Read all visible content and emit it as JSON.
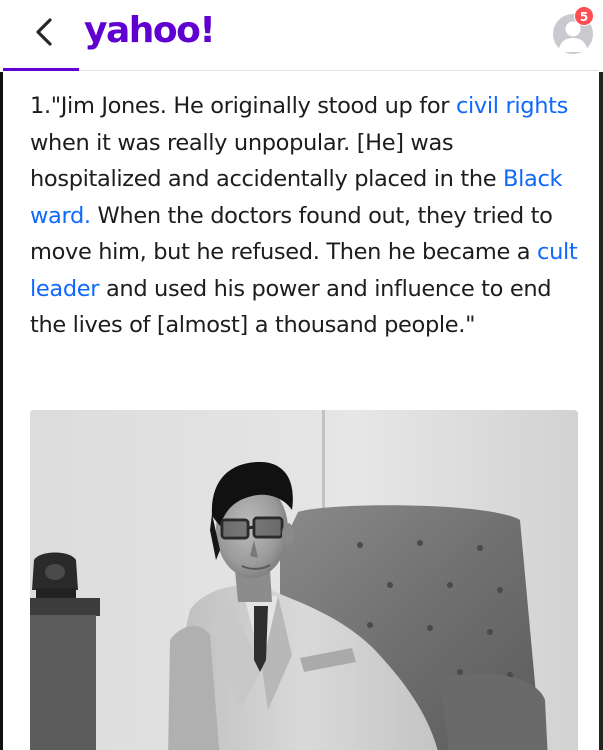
{
  "header": {
    "logo_text": "yahoo!",
    "notification_count": "5",
    "back_icon": "chevron-left-icon",
    "avatar_icon": "user-avatar-icon",
    "brand_color": "#6001d2",
    "badge_color": "#ff4d52"
  },
  "article": {
    "seg1": "1.\"Jim Jones. He originally stood up for ",
    "link1": "civil rights",
    "seg2": " when it was really unpopular. [He] was hospitalized and accidentally placed in the ",
    "link2": "Black ward.",
    "seg3": " When the doctors found out, they tried to move him, but he refused. Then he became a ",
    "link3": "cult leader",
    "seg4": " and used his power and influence to end the lives of [almost] a thousand people.\"",
    "link_color": "#0f69ff"
  },
  "photo": {
    "type": "black-and-white photograph",
    "icon": "photo-image"
  }
}
